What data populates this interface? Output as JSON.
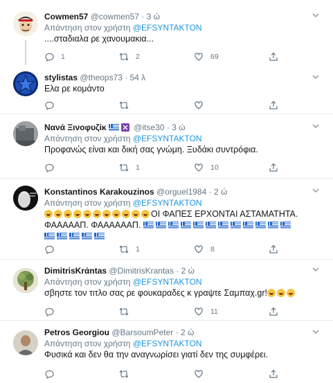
{
  "tweets": [
    {
      "name": "Cowmen57",
      "handle": "@cowmen57",
      "time": "3 ώ",
      "reply_prefix": "Απάντηση στον χρήστη",
      "reply_mention": "@EFSYNTAKTON",
      "text": "....σταδιαλα ρε χανουμακια...",
      "replies": "1",
      "retweets": "2",
      "likes": "69"
    },
    {
      "name": "stylistas",
      "handle": "@theops73",
      "time": "54 λ",
      "reply_prefix": "",
      "reply_mention": "",
      "text": "Ελα ρε κομάντο",
      "replies": "",
      "retweets": "",
      "likes": ""
    },
    {
      "name": "Νανά Ξινοφυζίκ",
      "handle": "@itse30",
      "time": "3 ώ",
      "reply_prefix": "Απάντηση στον χρήστη",
      "reply_mention": "@EFSYNTAKTON",
      "text": "Προφανώς είναι και δική σας γνώμη. Ξυδάκι συντρόφια.",
      "replies": "",
      "retweets": "1",
      "likes": "10"
    },
    {
      "name": "Konstantinos Karakouzinos",
      "handle": "@orguel1984",
      "time": "2 ώ",
      "reply_prefix": "Απάντηση στον χρήστη",
      "reply_mention": "@EFSYNTAKTON",
      "text": "ΟΙ ΦΑΠΕΣ ΕΡΧΟΝΤΑΙ ΑΣΤΑΜΑΤΗΤΑ.",
      "text2": "ΦΑΑΑΑΑΠ. ΦΑΑΑΑΑΑΠ.",
      "replies": "",
      "retweets": "1",
      "likes": "8"
    },
    {
      "name": "DimitrisKrάntas",
      "handle": "@DimitrisKrantas",
      "time": "2 ώ",
      "reply_prefix": "Απάντηση στον χρήστη",
      "reply_mention": "@EFSYNTAKTON",
      "text": "σβηστε τον τιτλο σας ρε φουκαραδες κ γραψτε  Σαμπαχ.gr!",
      "replies": "",
      "retweets": "",
      "likes": "11"
    },
    {
      "name": "Petros Georgiou",
      "handle": "@BarsoumPeter",
      "time": "2 ώ",
      "reply_prefix": "Απάντηση στον χρήστη",
      "reply_mention": "@EFSYNTAKTON",
      "text": "Φυσικά και δεν θα την αναγνωρίσει γιατί δεν της συμφέρει.",
      "replies": "",
      "retweets": "",
      "likes": ""
    }
  ],
  "separator": "·",
  "icons": {
    "reply": "reply-icon",
    "retweet": "retweet-icon",
    "like": "heart-icon",
    "share": "share-icon",
    "caret": "chevron-down-icon"
  },
  "colors": {
    "link": "#1b95e0",
    "muted": "#657786",
    "text": "#14171a",
    "border": "#e6ecf0"
  }
}
